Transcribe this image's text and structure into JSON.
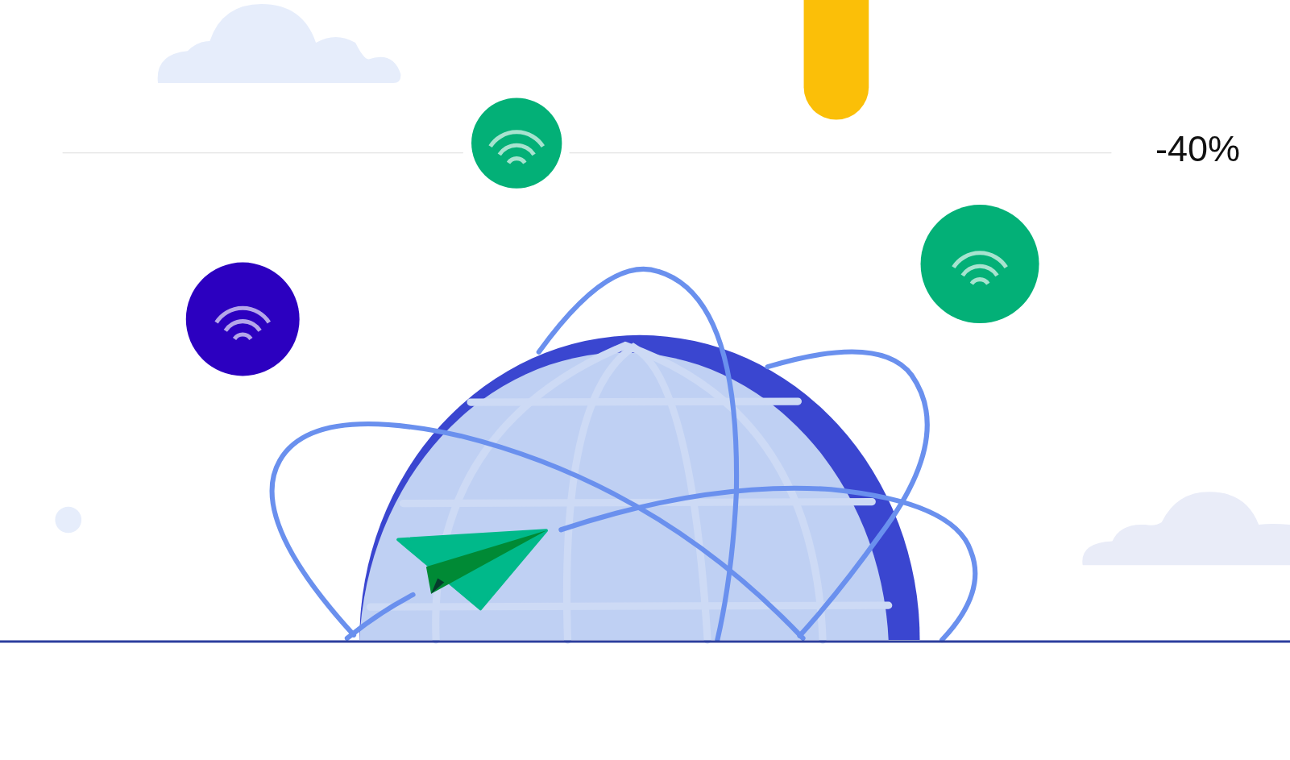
{
  "discount": "-40%"
}
